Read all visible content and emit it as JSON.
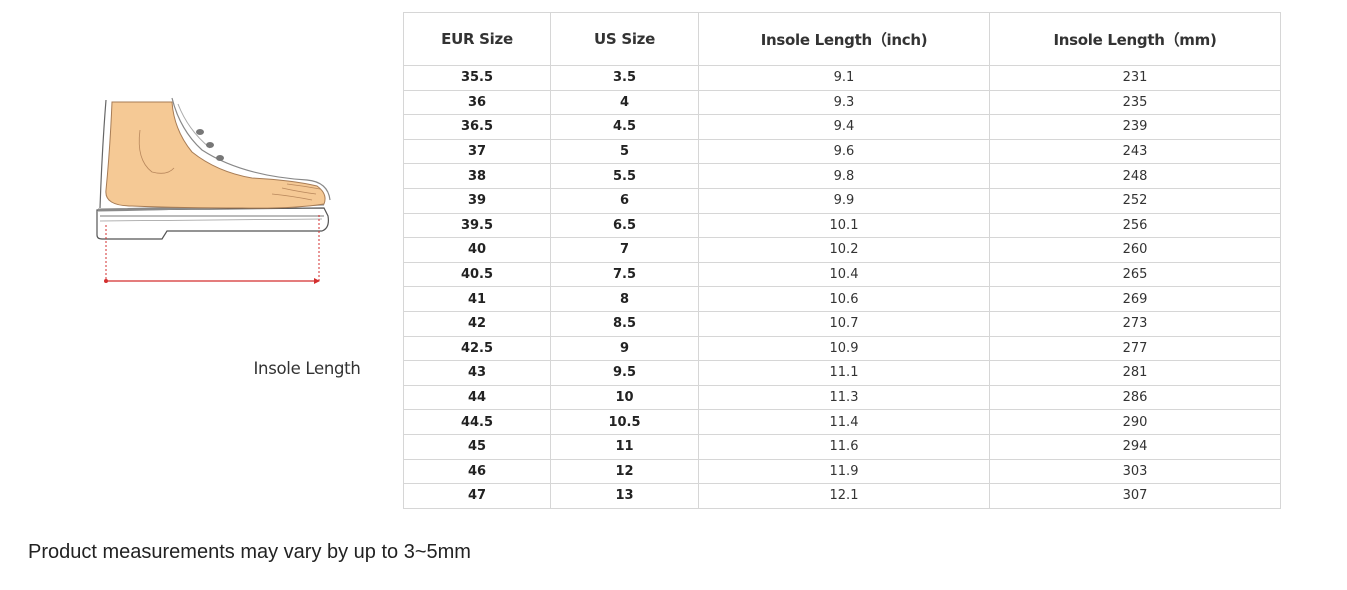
{
  "illustration": {
    "icon": "foot-in-shoe-icon",
    "label": "Insole Length",
    "arrow_color": "#d32f2f",
    "skin_color": "#f5c995"
  },
  "table": {
    "headers": [
      "EUR Size",
      "US Size",
      "Insole Length（inch)",
      "Insole Length（mm)"
    ],
    "rows": [
      [
        "35.5",
        "3.5",
        "9.1",
        "231"
      ],
      [
        "36",
        "4",
        "9.3",
        "235"
      ],
      [
        "36.5",
        "4.5",
        "9.4",
        "239"
      ],
      [
        "37",
        "5",
        "9.6",
        "243"
      ],
      [
        "38",
        "5.5",
        "9.8",
        "248"
      ],
      [
        "39",
        "6",
        "9.9",
        "252"
      ],
      [
        "39.5",
        "6.5",
        "10.1",
        "256"
      ],
      [
        "40",
        "7",
        "10.2",
        "260"
      ],
      [
        "40.5",
        "7.5",
        "10.4",
        "265"
      ],
      [
        "41",
        "8",
        "10.6",
        "269"
      ],
      [
        "42",
        "8.5",
        "10.7",
        "273"
      ],
      [
        "42.5",
        "9",
        "10.9",
        "277"
      ],
      [
        "43",
        "9.5",
        "11.1",
        "281"
      ],
      [
        "44",
        "10",
        "11.3",
        "286"
      ],
      [
        "44.5",
        "10.5",
        "11.4",
        "290"
      ],
      [
        "45",
        "11",
        "11.6",
        "294"
      ],
      [
        "46",
        "12",
        "11.9",
        "303"
      ],
      [
        "47",
        "13",
        "12.1",
        "307"
      ]
    ]
  },
  "footnote": "Product measurements may vary by up to 3~5mm"
}
